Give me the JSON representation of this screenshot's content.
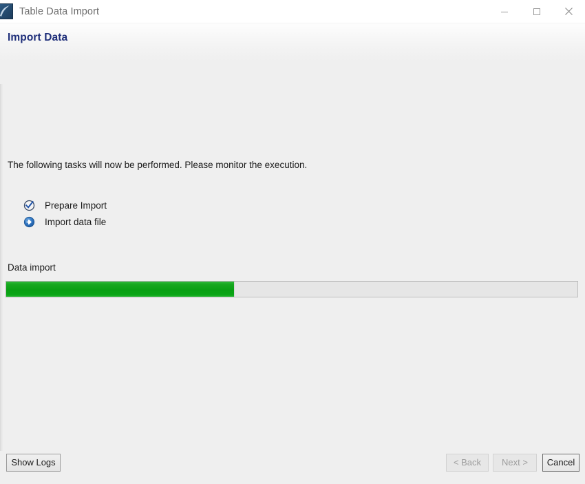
{
  "window": {
    "title": "Table Data Import",
    "icon": "workbench-app-icon",
    "controls": [
      {
        "name": "minimize",
        "glyph": "minimize-icon"
      },
      {
        "name": "maximize",
        "glyph": "maximize-icon"
      },
      {
        "name": "close",
        "glyph": "close-icon"
      }
    ]
  },
  "header": {
    "title": "Import Data",
    "title_color": "#1f2f7a"
  },
  "main": {
    "intro_text": "The following tasks will now be performed. Please monitor the execution.",
    "tasks": [
      {
        "label": "Prepare Import",
        "status": "done",
        "icon": "check-circle-icon"
      },
      {
        "label": "Import data file",
        "status": "in-progress",
        "icon": "arrow-circle-right-icon"
      }
    ],
    "progress": {
      "label": "Data import",
      "percent": 40,
      "fill_color": "#0ba516",
      "track_color": "#e6e6e6"
    }
  },
  "footer": {
    "show_logs_label": "Show Logs",
    "back_label": "< Back",
    "next_label": "Next >",
    "cancel_label": "Cancel"
  }
}
